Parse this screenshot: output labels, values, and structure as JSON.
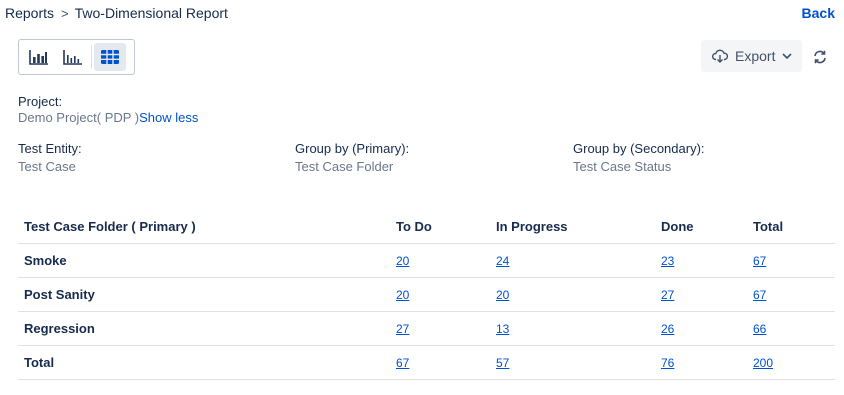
{
  "breadcrumb": {
    "parent": "Reports",
    "separator": ">",
    "current": "Two-Dimensional Report"
  },
  "back_label": "Back",
  "view_toggle": {
    "buttons": [
      {
        "icon": "bar-chart-icon",
        "active": false
      },
      {
        "icon": "column-chart-icon",
        "active": false
      },
      {
        "icon": "table-grid-icon",
        "active": true
      }
    ]
  },
  "toolbar": {
    "export_label": "Export",
    "export_icon": "cloud-download-icon",
    "refresh_icon": "refresh-icon"
  },
  "filters": {
    "project_label": "Project:",
    "project_value": "Demo Project( PDP )",
    "show_less": "Show less",
    "test_entity_label": "Test Entity:",
    "test_entity_value": "Test Case",
    "group_primary_label": "Group by (Primary):",
    "group_primary_value": "Test Case Folder",
    "group_secondary_label": "Group by (Secondary):",
    "group_secondary_value": "Test Case Status"
  },
  "table": {
    "headers": [
      "Test Case Folder ( Primary )",
      "To Do",
      "In Progress",
      "Done",
      "Total"
    ],
    "rows": [
      {
        "label": "Smoke",
        "values": [
          "20",
          "24",
          "23",
          "67"
        ]
      },
      {
        "label": "Post Sanity",
        "values": [
          "20",
          "20",
          "27",
          "67"
        ]
      },
      {
        "label": "Regression",
        "values": [
          "27",
          "13",
          "26",
          "66"
        ]
      },
      {
        "label": "Total",
        "values": [
          "67",
          "57",
          "76",
          "200"
        ]
      }
    ]
  },
  "colors": {
    "link": "#0052cc",
    "text": "#172b4d",
    "muted": "#6b778c",
    "border": "#dfe1e6",
    "active_toggle": "#e4e9f0"
  }
}
